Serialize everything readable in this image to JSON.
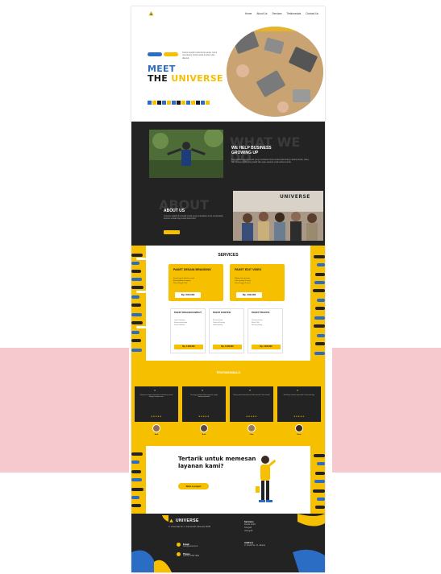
{
  "nav": {
    "items": [
      "Home",
      "About Us",
      "Services",
      "Testimonials",
      "Contact Us"
    ]
  },
  "hero": {
    "tagline": "Solusi kreatif untuk bisnis anda. Kami membantu brand anda tumbuh dan dikenal.",
    "title_line1": "MEET",
    "title_line2a": "THE ",
    "title_line2b": "UNIVERSE"
  },
  "about": {
    "ghost1": "WHAT WE DO",
    "help_title": "WE HELP BUSINESS GROWING UP",
    "help_text": "Kami adalah agensi kreatif yang membantu bisnis anda berkembang melalui desain, video, dan strategi digital yang efektif dan tepat sasaran untuk audiens anda.",
    "ghost2": "ABOUT",
    "about_title": "ABOUT US",
    "about_text": "Universe adalah tim kreatif muda yang berdedikasi untuk memberikan layanan terbaik bagi setiap klien kami.",
    "brand_sign": "UNIVERSE"
  },
  "services": {
    "title": "SERVICES",
    "featured": [
      {
        "name": "PAKET DESAIN BRANDING",
        "items": [
          "Desain logo & identitas visual",
          "Brand guideline lengkap",
          "Revisi hingga 3 kali"
        ],
        "price": "Rp. 500.000"
      },
      {
        "name": "PAKET EDIT VIDEO",
        "items": [
          "Editing video promosi",
          "Color grading & sound",
          "Durasi hingga 3 menit"
        ],
        "price": "Rp. 400.000"
      }
    ],
    "small": [
      {
        "name": "PAKET DESAIN KOMPLIT",
        "items": [
          "Logo & branding",
          "Konten sosial media",
          "Desain kemasan"
        ],
        "price": "Rp. 1.000.000"
      },
      {
        "name": "PAKET KONTEN",
        "items": [
          "30 konten feed",
          "Caption & hashtag",
          "Jadwal posting"
        ],
        "price": "Rp. 1.400.000"
      },
      {
        "name": "PAKET PRAKTIS",
        "items": [
          "10 desain konten",
          "Revisi 2 kali",
          "File siap posting"
        ],
        "price": "Rp. 2.000.000"
      }
    ]
  },
  "testimonials": {
    "title": "TESTIMONIALS",
    "cards": [
      {
        "text": "Pelayanan sangat memuaskan, hasil desain sesuai dengan harapan kami.",
        "stars": "★★★★★",
        "name": "Andi"
      },
      {
        "text": "Tim yang profesional dan responsif, sangat direkomendasikan.",
        "stars": "★★★★★",
        "name": "Budi"
      },
      {
        "text": "Video promosi kami jadi jauh lebih menarik. Terima kasih!",
        "stars": "★★★★★",
        "name": "Citra"
      },
      {
        "text": "Hasil kerja rapi dan tepat waktu. Pasti order lagi.",
        "stars": "★★★★★",
        "name": "Dewi"
      }
    ]
  },
  "cta": {
    "title": "Tertarik untuk memesan layanan kami?",
    "button": "Start a project"
  },
  "footer": {
    "brand": "UNIVERSE",
    "address": "Jl. Universitas No. 1, Kota Kreatif, Indonesia 12345",
    "email_label": "Email",
    "email_value": "hello@universe.id",
    "phone_label": "Phone",
    "phone_value": "+62 812 3456 7890",
    "services_head": "Services",
    "services_items": [
      "Desain Grafis",
      "Fotografi",
      "Videografi"
    ],
    "address_head": "Address",
    "address_text": "Jl. Kreatif No. 10, Jakarta"
  },
  "colors": {
    "yellow": "#f6c000",
    "blue": "#2b6cc4",
    "dark": "#232323"
  }
}
